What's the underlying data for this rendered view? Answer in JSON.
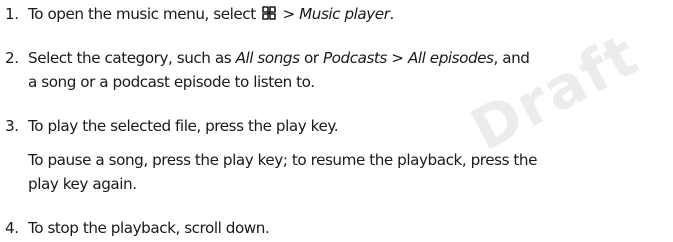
{
  "watermark": "Draft",
  "steps": [
    {
      "number": "1.",
      "lines": [
        {
          "parts": [
            {
              "text": "To open the music menu, select "
            },
            {
              "icon": "menu-icon"
            },
            {
              "text": " > "
            },
            {
              "text": "Music player",
              "italic": true
            },
            {
              "text": "."
            }
          ]
        }
      ]
    },
    {
      "number": "2.",
      "lines": [
        {
          "parts": [
            {
              "text": "Select the category, such as "
            },
            {
              "text": "All songs",
              "italic": true
            },
            {
              "text": " or "
            },
            {
              "text": "Podcasts",
              "italic": true
            },
            {
              "text": " > "
            },
            {
              "text": "All episodes",
              "italic": true
            },
            {
              "text": ", and"
            }
          ]
        },
        {
          "parts": [
            {
              "text": "a song or a podcast episode to listen to."
            }
          ]
        }
      ]
    },
    {
      "number": "3.",
      "lines": [
        {
          "parts": [
            {
              "text": "To play the selected file, press the play key."
            }
          ]
        },
        {
          "parts": [
            {
              "text": "To pause a song, press the play key; to resume the playback, press the"
            }
          ]
        },
        {
          "parts": [
            {
              "text": "play key again."
            }
          ]
        }
      ]
    },
    {
      "number": "4.",
      "lines": [
        {
          "parts": [
            {
              "text": "To stop the playback, scroll down."
            }
          ]
        }
      ]
    }
  ]
}
